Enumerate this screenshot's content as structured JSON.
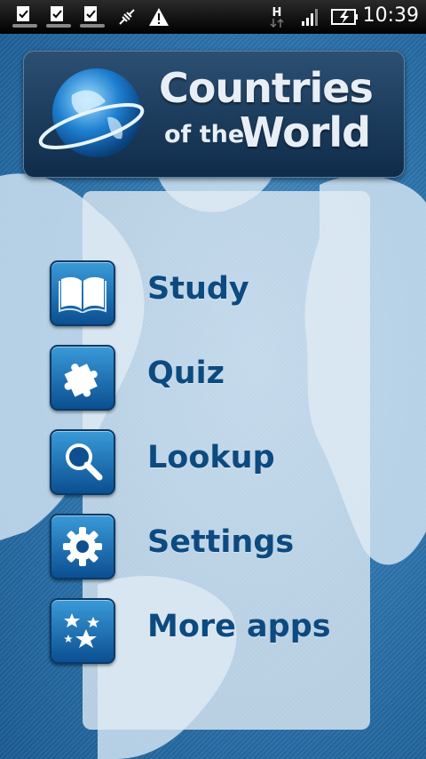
{
  "status_bar": {
    "time": "10:39",
    "network_label": "H",
    "icons": [
      "download-complete-icon",
      "download-complete-icon",
      "download-complete-icon",
      "usb-debug-icon",
      "warning-icon",
      "network-h-icon",
      "signal-icon",
      "battery-charging-icon"
    ]
  },
  "header": {
    "title_line1": "Countries",
    "title_line2_small": "of the",
    "title_line2_big": "World",
    "logo_icon": "globe-icon"
  },
  "menu": [
    {
      "label": "Study",
      "icon": "book-icon"
    },
    {
      "label": "Quiz",
      "icon": "puzzle-icon"
    },
    {
      "label": "Lookup",
      "icon": "magnifier-icon"
    },
    {
      "label": "Settings",
      "icon": "gear-icon"
    },
    {
      "label": "More apps",
      "icon": "stars-icon"
    }
  ],
  "colors": {
    "label": "#0d4a80",
    "icon_tile": "#1f6fb8",
    "banner": "#1c3d60",
    "background": "#2f77b0"
  }
}
